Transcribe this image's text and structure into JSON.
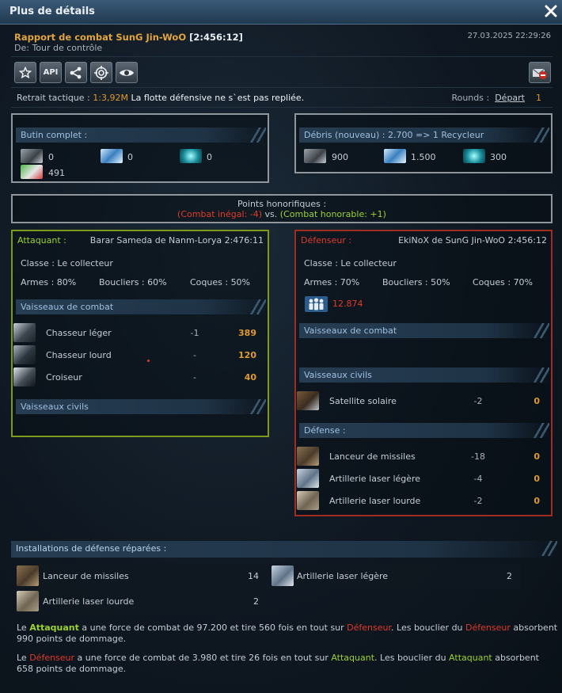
{
  "window": {
    "title": "Plus de détails"
  },
  "report": {
    "title": "Rapport de combat SunG Jin-WoO",
    "coords": "[2:456:12]",
    "from": "De: Tour de contrôle",
    "date": "27.03.2025 22:29:26"
  },
  "toolbar": {
    "buttons": [
      "favorite-icon",
      "API",
      "share-icon",
      "target-icon",
      "eye-icon"
    ],
    "api_label": "API"
  },
  "retreat": {
    "label": "Retrait tactique :",
    "ratio": "1:3,92M",
    "message": "La flotte défensive ne s`est pas repliée."
  },
  "rounds": {
    "label": "Rounds :",
    "link": "Départ",
    "value": "1"
  },
  "loot": {
    "title": "Butin complet :",
    "metal": "0",
    "crystal": "0",
    "deuterium": "0",
    "food": "491"
  },
  "debris": {
    "title": "Débris (nouveau) : 2.700 => 1 Recycleur",
    "metal": "900",
    "crystal": "1.500",
    "deuterium": "300"
  },
  "honor": {
    "title": "Points honorifiques :",
    "left": "(Combat inégal: -4)",
    "mid": "vs.",
    "right": "(Combat honorable: +1)"
  },
  "attacker": {
    "label": "Attaquant :",
    "name": "Barar Sameda de Nanm-Lorya 2:476:11",
    "class": "Classe : Le collecteur",
    "weapons": "Armes : 80%",
    "shields": "Boucliers : 60%",
    "hull": "Coques : 50%",
    "combat_title": "Vaisseaux de combat",
    "ships": [
      {
        "name": "Chasseur léger",
        "loss": "-1",
        "left": "389"
      },
      {
        "name": "Chasseur lourd",
        "loss": "-",
        "left": "120"
      },
      {
        "name": "Croiseur",
        "loss": "-",
        "left": "40"
      }
    ],
    "civil_title": "Vaisseaux civils"
  },
  "defender": {
    "label": "Défenseur :",
    "name": "EkiNoX de SunG Jin-WoO 2:456:12",
    "class": "Classe : Le collecteur",
    "weapons": "Armes : 70%",
    "shields": "Boucliers : 50%",
    "hull": "Coques : 70%",
    "population": "12.874",
    "combat_title": "Vaisseaux de combat",
    "civil_title": "Vaisseaux civils",
    "civil_ships": [
      {
        "name": "Satellite solaire",
        "loss": "-2",
        "left": "0"
      }
    ],
    "defense_title": "Défense :",
    "defenses": [
      {
        "name": "Lanceur de missiles",
        "loss": "-18",
        "left": "0"
      },
      {
        "name": "Artillerie laser légère",
        "loss": "-4",
        "left": "0"
      },
      {
        "name": "Artillerie laser lourde",
        "loss": "-2",
        "left": "0"
      }
    ]
  },
  "repaired": {
    "title": "Installations de défense réparées :",
    "items": [
      {
        "name": "Lanceur de missiles",
        "count": "14"
      },
      {
        "name": "Artillerie laser légère",
        "count": "2"
      },
      {
        "name": "Artillerie laser lourde",
        "count": "2"
      }
    ]
  },
  "summary": {
    "p1": {
      "a": "Le ",
      "b": "Attaquant",
      "c": " a une force de combat de 97.200 et tire 560 fois en tout sur ",
      "d": "Défenseur",
      "e": ". Les bouclier du ",
      "f": "Défenseur",
      "g": " absorbent 990 points de dommage."
    },
    "p2": {
      "a": "Le ",
      "b": "Défenseur",
      "c": " a une force de combat de 3.980 et tire 26 fois en tout sur ",
      "d": "Attaquant",
      "e": ". Les bouclier du ",
      "f": "Attaquant",
      "g": " absorbent 658 points de dommage."
    }
  }
}
